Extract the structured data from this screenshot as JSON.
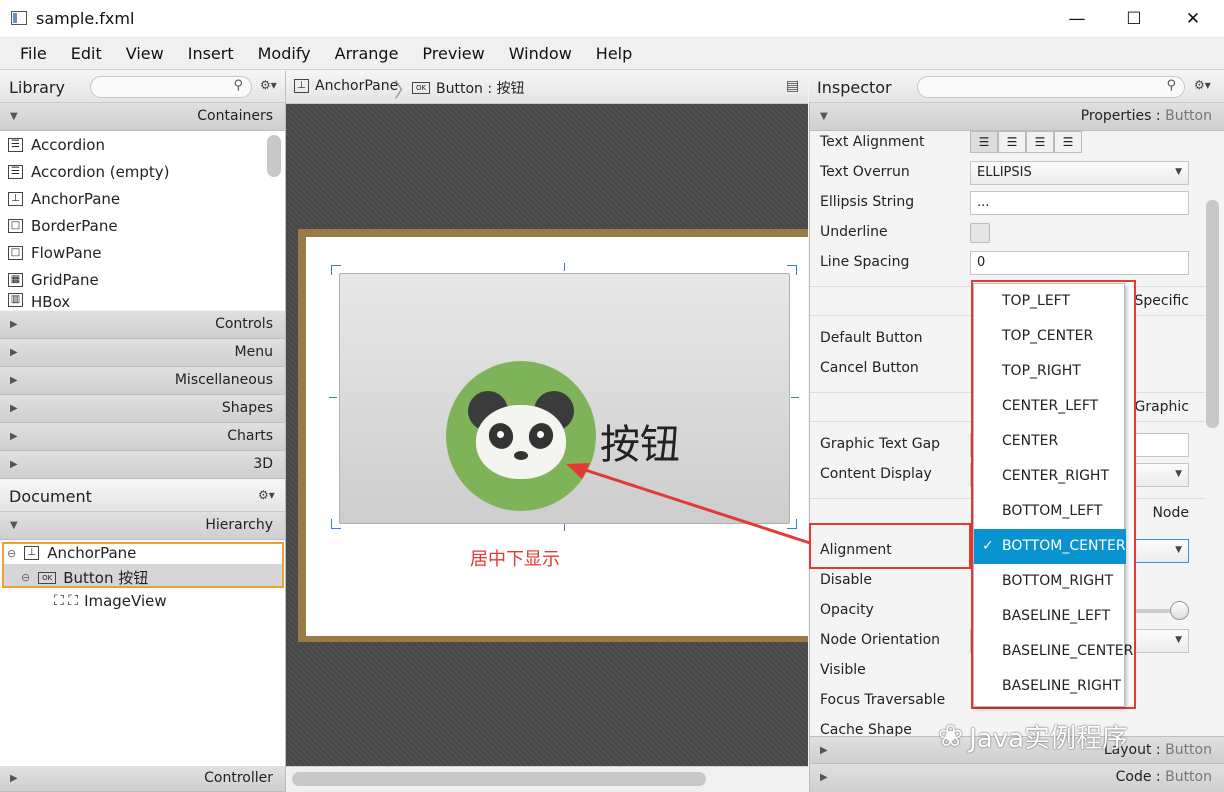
{
  "window": {
    "title": "sample.fxml",
    "minimize": "—",
    "maximize": "☐",
    "close": "✕"
  },
  "menu": [
    "File",
    "Edit",
    "View",
    "Insert",
    "Modify",
    "Arrange",
    "Preview",
    "Window",
    "Help"
  ],
  "library": {
    "title": "Library",
    "containers_label": "Containers",
    "items": [
      "Accordion",
      "Accordion  (empty)",
      "AnchorPane",
      "BorderPane",
      "FlowPane",
      "GridPane",
      "HBox"
    ],
    "sections": [
      "Controls",
      "Menu",
      "Miscellaneous",
      "Shapes",
      "Charts",
      "3D"
    ]
  },
  "document": {
    "title": "Document",
    "hierarchy_label": "Hierarchy",
    "tree": [
      "AnchorPane",
      "Button  按钮",
      "ImageView"
    ],
    "controller_label": "Controller"
  },
  "breadcrumb": {
    "root": "AnchorPane",
    "child": "Button : 按钮"
  },
  "canvas": {
    "button_text": "按钮",
    "annotation": "居中下显示"
  },
  "inspector": {
    "title": "Inspector",
    "properties_label": "Properties",
    "properties_target": "Button",
    "rows": {
      "text_alignment": "Text Alignment",
      "text_overrun": "Text Overrun",
      "text_overrun_value": "ELLIPSIS",
      "ellipsis_string": "Ellipsis String",
      "ellipsis_value": "...",
      "underline": "Underline",
      "line_spacing": "Line Spacing",
      "line_spacing_value": "0",
      "specific": "Specific",
      "default_button": "Default Button",
      "cancel_button": "Cancel Button",
      "graphic": "Graphic",
      "graphic_text_gap": "Graphic Text Gap",
      "content_display": "Content Display",
      "node": "Node",
      "alignment": "Alignment",
      "disable": "Disable",
      "opacity": "Opacity",
      "node_orientation": "Node Orientation",
      "visible": "Visible",
      "focus_traversable": "Focus Traversable",
      "cache_shape": "Cache Shape"
    },
    "layout_label": "Layout",
    "layout_target": "Button",
    "code_label": "Code",
    "code_target": "Button"
  },
  "alignment_options": [
    "TOP_LEFT",
    "TOP_CENTER",
    "TOP_RIGHT",
    "CENTER_LEFT",
    "CENTER",
    "CENTER_RIGHT",
    "BOTTOM_LEFT",
    "BOTTOM_CENTER",
    "BOTTOM_RIGHT",
    "BASELINE_LEFT",
    "BASELINE_CENTER",
    "BASELINE_RIGHT"
  ],
  "alignment_selected": "BOTTOM_CENTER",
  "watermark": "Java实例程序",
  "colors": {
    "selection": "#0a93d1",
    "highlight_box": "#e53935",
    "panda_bg": "#7fb35a",
    "frame": "#9a7b47"
  }
}
